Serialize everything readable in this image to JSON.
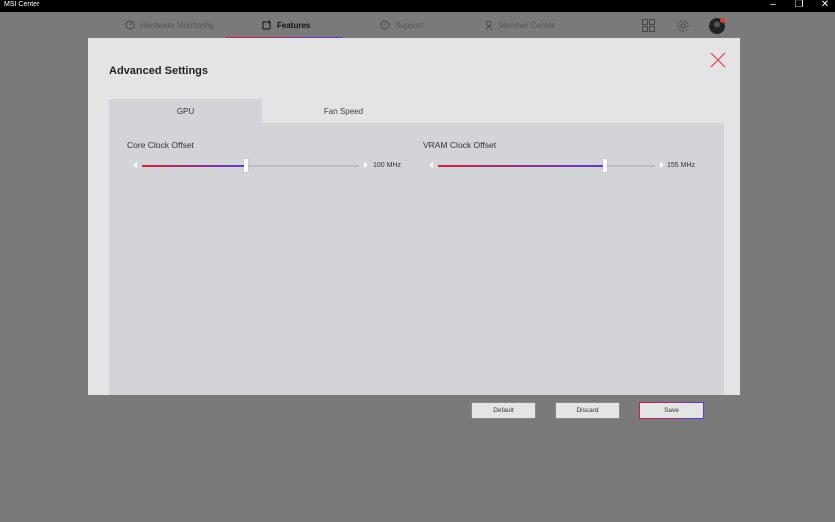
{
  "window": {
    "title": "MSI Center",
    "controls": {
      "minimize": "–",
      "restore": "❐",
      "close": "✕"
    }
  },
  "nav": {
    "tabs": [
      {
        "label": "Hardware Monitoring",
        "icon": "gauge-icon"
      },
      {
        "label": "Features",
        "icon": "features-icon",
        "active": true
      },
      {
        "label": "Support",
        "icon": "support-icon"
      },
      {
        "label": "Member Center",
        "icon": "user-icon"
      }
    ],
    "right_icons": [
      "grid-icon",
      "settings-icon",
      "avatar"
    ]
  },
  "dialog": {
    "title": "Advanced Settings",
    "tabs": [
      {
        "label": "GPU",
        "active": true
      },
      {
        "label": "Fan Speed"
      }
    ],
    "sliders": {
      "core_clock": {
        "label": "Core Clock Offset",
        "value": "100 MHz",
        "fraction": 0.48
      },
      "vram_clock": {
        "label": "VRAM Clock Offset",
        "value": "155 MHz",
        "fraction": 0.77
      }
    },
    "buttons": {
      "default": "Default",
      "discard": "Discard",
      "save": "Save"
    }
  },
  "colors": {
    "accent_red": "#d0213c",
    "accent_purple": "#5a3ccf",
    "notification": "#e53935"
  }
}
